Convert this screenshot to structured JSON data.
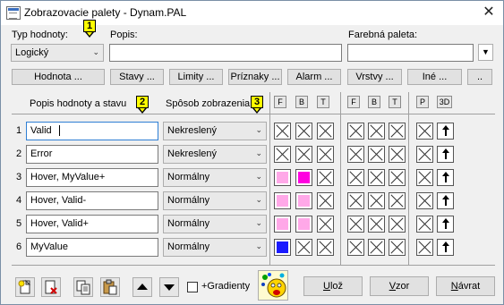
{
  "window": {
    "title": "Zobrazovacie palety - Dynam.PAL",
    "close_glyph": "✕"
  },
  "top": {
    "type_label": "Typ hodnoty:",
    "type_value": "Logický",
    "desc_label": "Popis:",
    "desc_value": "",
    "palette_label": "Farebná paleta:",
    "palette_value": ""
  },
  "callouts": [
    "1",
    "2",
    "3"
  ],
  "tabs": [
    "Hodnota ...",
    "Stavy ...",
    "Limity ...",
    "Príznaky ...",
    "Alarm ...",
    "Vrstvy ...",
    "Iné ...",
    ".."
  ],
  "columns": {
    "desc_header": "Popis hodnoty a stavu",
    "mode_header": "Spôsob zobrazenia",
    "group1": [
      "F",
      "B",
      "T"
    ],
    "group2": [
      "F",
      "B",
      "T"
    ],
    "group3": [
      "P",
      "3D"
    ]
  },
  "rows": [
    {
      "num": "1",
      "desc": "Valid",
      "mode": "Nekreslený",
      "f": "x",
      "b": "x",
      "t": "x"
    },
    {
      "num": "2",
      "desc": "Error",
      "mode": "Nekreslený",
      "f": "x",
      "b": "x",
      "t": "x"
    },
    {
      "num": "3",
      "desc": "Hover, MyValue+",
      "mode": "Normálny",
      "f": "#ffa8e8",
      "b": "#ff00e0",
      "t": "x"
    },
    {
      "num": "4",
      "desc": "Hover, Valid-",
      "mode": "Normálny",
      "f": "#ffa8e8",
      "b": "#ffa8e8",
      "t": "x"
    },
    {
      "num": "5",
      "desc": "Hover, Valid+",
      "mode": "Normálny",
      "f": "#ffa8e8",
      "b": "#ffa8e8",
      "t": "x"
    },
    {
      "num": "6",
      "desc": "MyValue",
      "mode": "Normálny",
      "f": "#1a1aff",
      "b": "x",
      "t": "x"
    }
  ],
  "bottom": {
    "gradient_label": "+Gradienty",
    "gradient_checked": false,
    "save": {
      "pre": "",
      "ul": "U",
      "post": "lož"
    },
    "sample": {
      "pre": "",
      "ul": "V",
      "post": "zor"
    },
    "back": {
      "pre": "",
      "ul": "N",
      "post": "ávrat"
    }
  },
  "icons": [
    "new-page-icon",
    "delete-page-icon",
    "copy-icon",
    "paste-icon",
    "move-up-icon",
    "move-down-icon",
    "palette-preview-icon"
  ]
}
